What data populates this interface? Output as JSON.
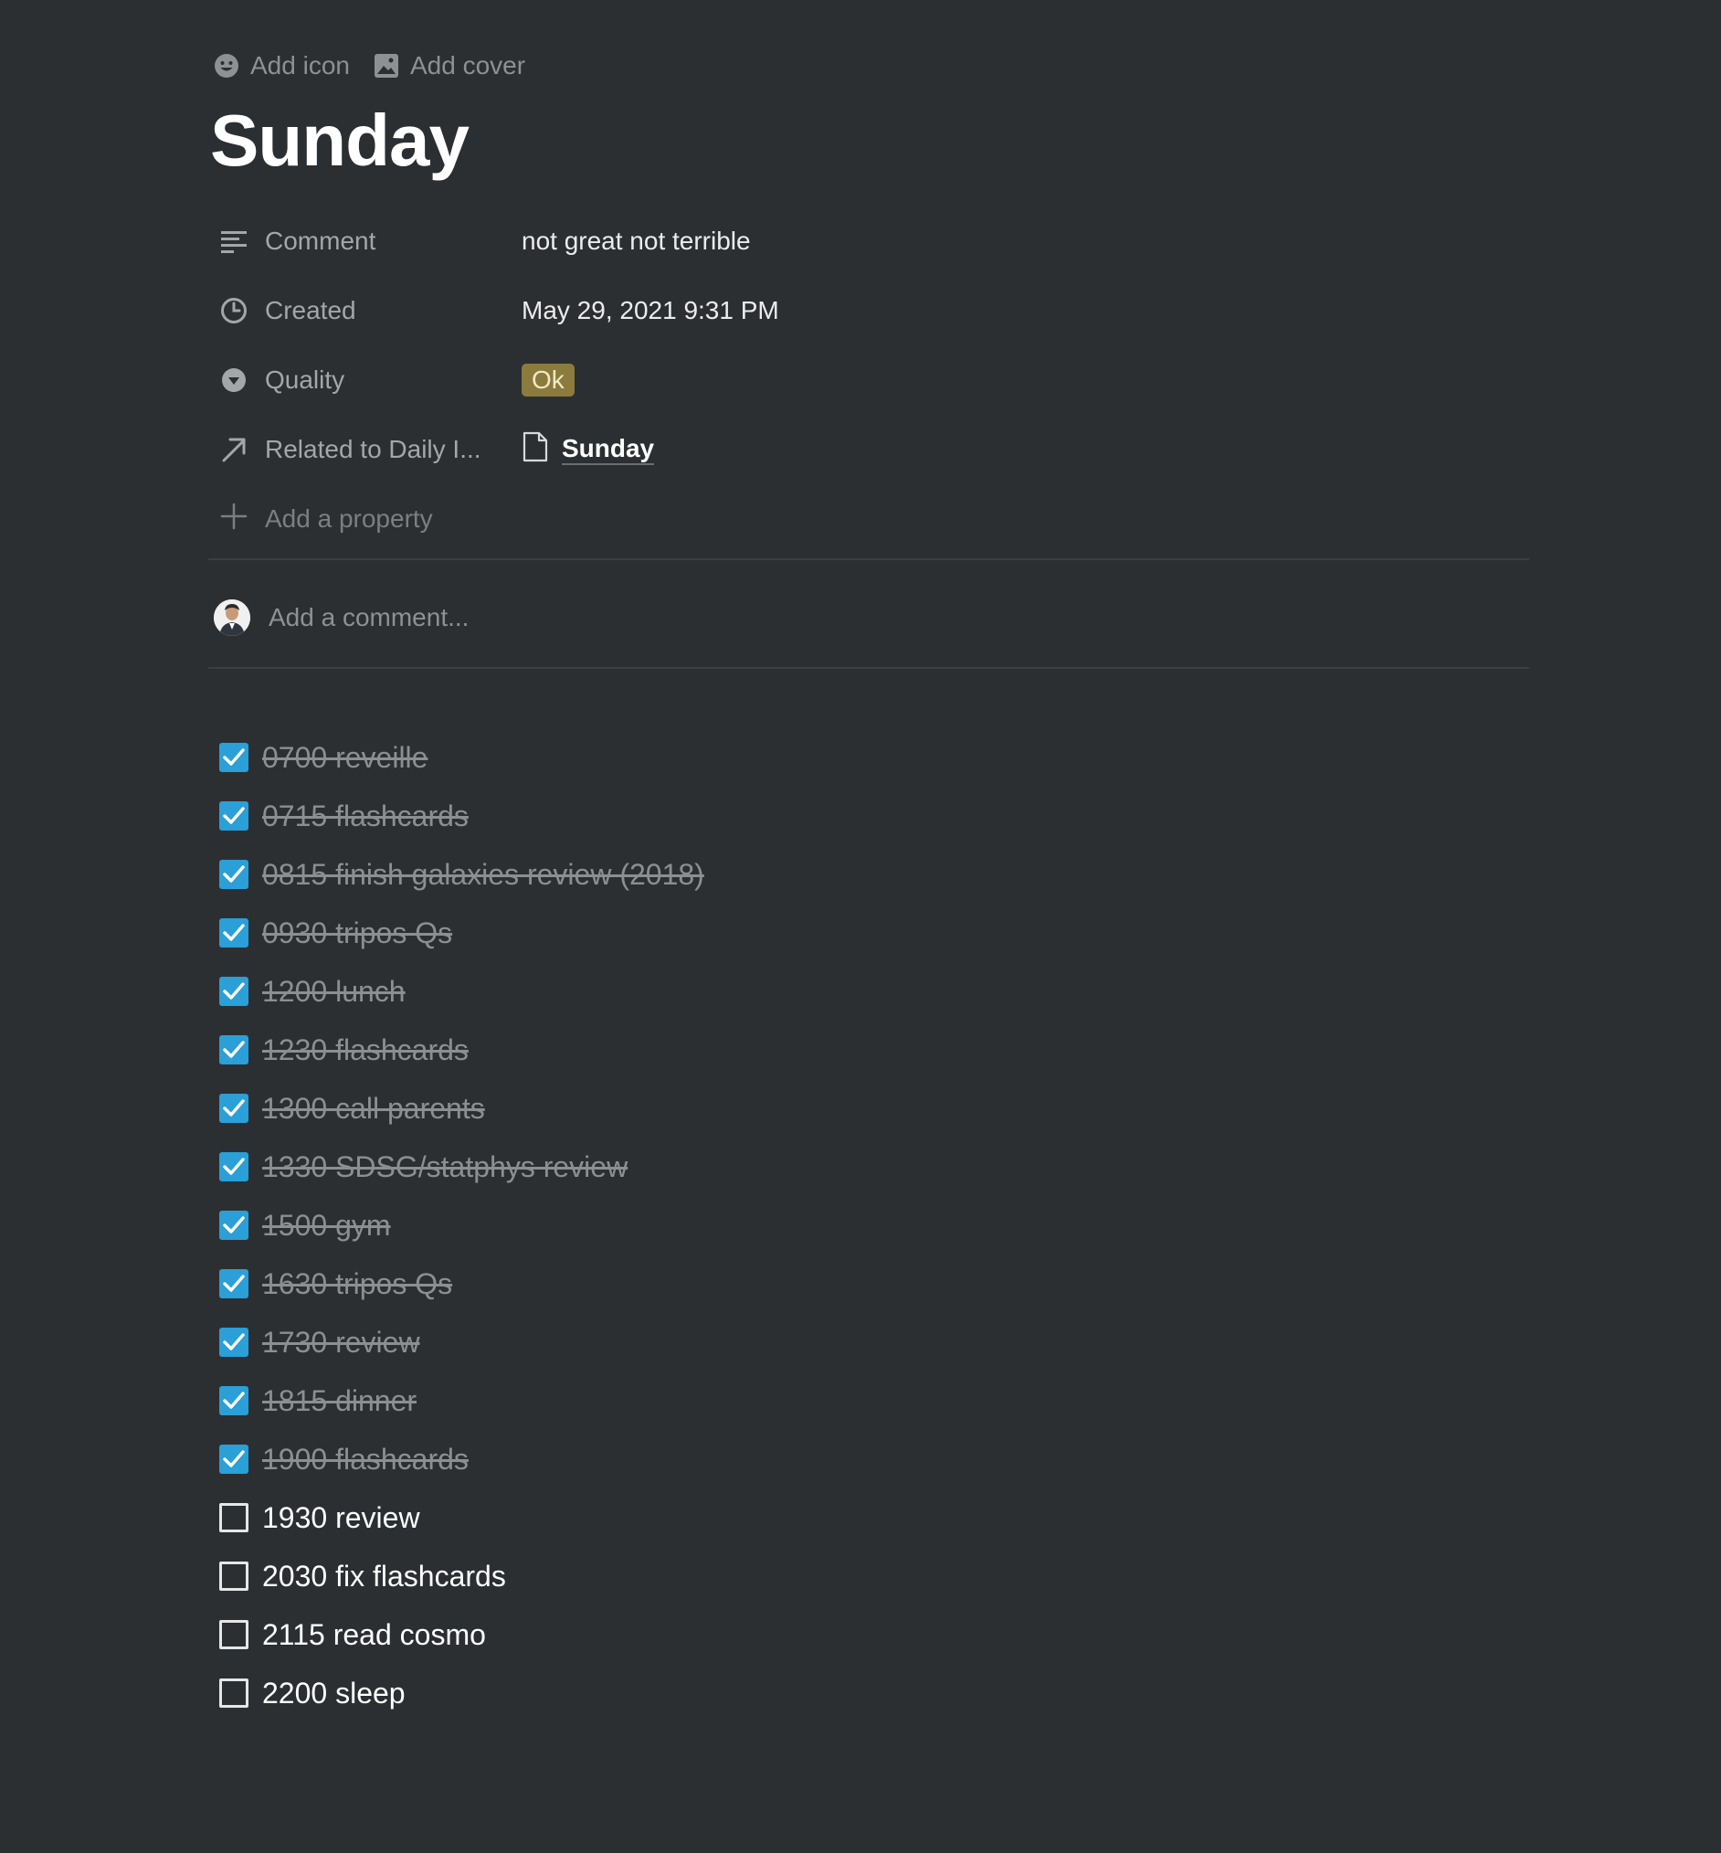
{
  "header": {
    "add_icon_label": "Add icon",
    "add_cover_label": "Add cover"
  },
  "page_title": "Sunday",
  "properties": [
    {
      "key": "Comment",
      "icon": "text-lines-icon",
      "value": "not great not terrible"
    },
    {
      "key": "Created",
      "icon": "clock-icon",
      "value": "May 29, 2021 9:31 PM"
    },
    {
      "key": "Quality",
      "icon": "select-circle-icon",
      "value": "Ok",
      "badge_color": "#8b7b3c"
    },
    {
      "key": "Related to Daily I...",
      "icon": "arrow-up-right-icon",
      "value": "Sunday",
      "value_icon": "page-icon"
    }
  ],
  "add_property_label": "Add a property",
  "comment": {
    "placeholder": "Add a comment..."
  },
  "todos": [
    {
      "text": "0700 reveille",
      "checked": true
    },
    {
      "text": "0715 flashcards",
      "checked": true
    },
    {
      "text": "0815 finish galaxies review (2018)",
      "checked": true
    },
    {
      "text": "0930 tripos Qs",
      "checked": true
    },
    {
      "text": "1200 lunch",
      "checked": true
    },
    {
      "text": "1230 flashcards",
      "checked": true
    },
    {
      "text": "1300 call parents",
      "checked": true
    },
    {
      "text": "1330 SDSG/statphys review",
      "checked": true
    },
    {
      "text": "1500 gym",
      "checked": true
    },
    {
      "text": "1630 tripos Qs",
      "checked": true
    },
    {
      "text": "1730 review",
      "checked": true
    },
    {
      "text": "1815 dinner",
      "checked": true
    },
    {
      "text": "1900 flashcards",
      "checked": true
    },
    {
      "text": "1930 review",
      "checked": false
    },
    {
      "text": "2030 fix flashcards",
      "checked": false
    },
    {
      "text": "2115 read cosmo",
      "checked": false
    },
    {
      "text": "2200 sleep",
      "checked": false
    }
  ],
  "colors": {
    "background": "#2b2f32",
    "checkbox_checked": "#2a9fd8",
    "badge_ok": "#8b7b3c"
  }
}
